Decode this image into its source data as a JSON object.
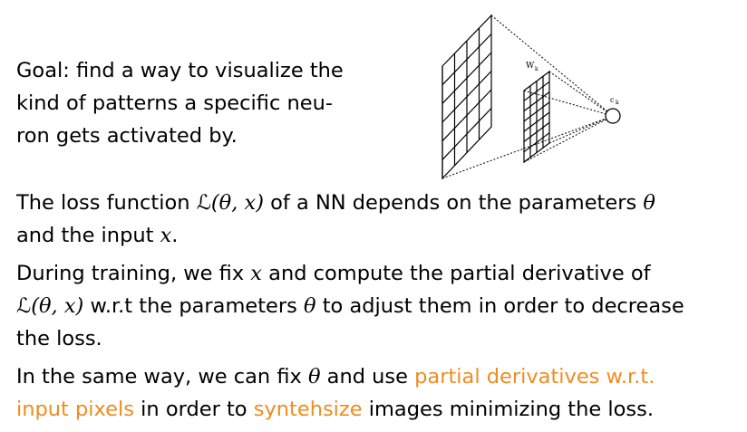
{
  "accent_color": "#f08c1e",
  "goal": {
    "line1": "Goal: find a way to visualize the",
    "line2": "kind of patterns a specific neu-",
    "line3": "ron gets activated by."
  },
  "diagram": {
    "filter_label": "W",
    "filter_sub": "k",
    "neuron_label": "c",
    "neuron_sub": "k"
  },
  "para1": {
    "t1": "The loss function ",
    "loss_L": "ℒ",
    "loss_args": "(θ, x)",
    "t2": " of a NN depends on the parameters ",
    "theta": "θ",
    "line2a": "and the input ",
    "x": "x",
    "line2b": "."
  },
  "para2": {
    "t1": "During training, we fix ",
    "x": "x",
    "t2": " and compute the partial derivative of",
    "loss_L": "ℒ",
    "loss_args": "(θ, x)",
    "t3": " w.r.t the parameters ",
    "theta": "θ",
    "t4": " to adjust them in order to decrease",
    "line3": "the loss."
  },
  "para3": {
    "t1": "In the same way, we can fix ",
    "theta": "θ",
    "t2": " and use ",
    "hl1a": "partial derivatives w.r.t.",
    "hl1b": "input pixels",
    "t3": " in order to ",
    "hl2": "syntehsize",
    "t4": " images minimizing the loss."
  }
}
